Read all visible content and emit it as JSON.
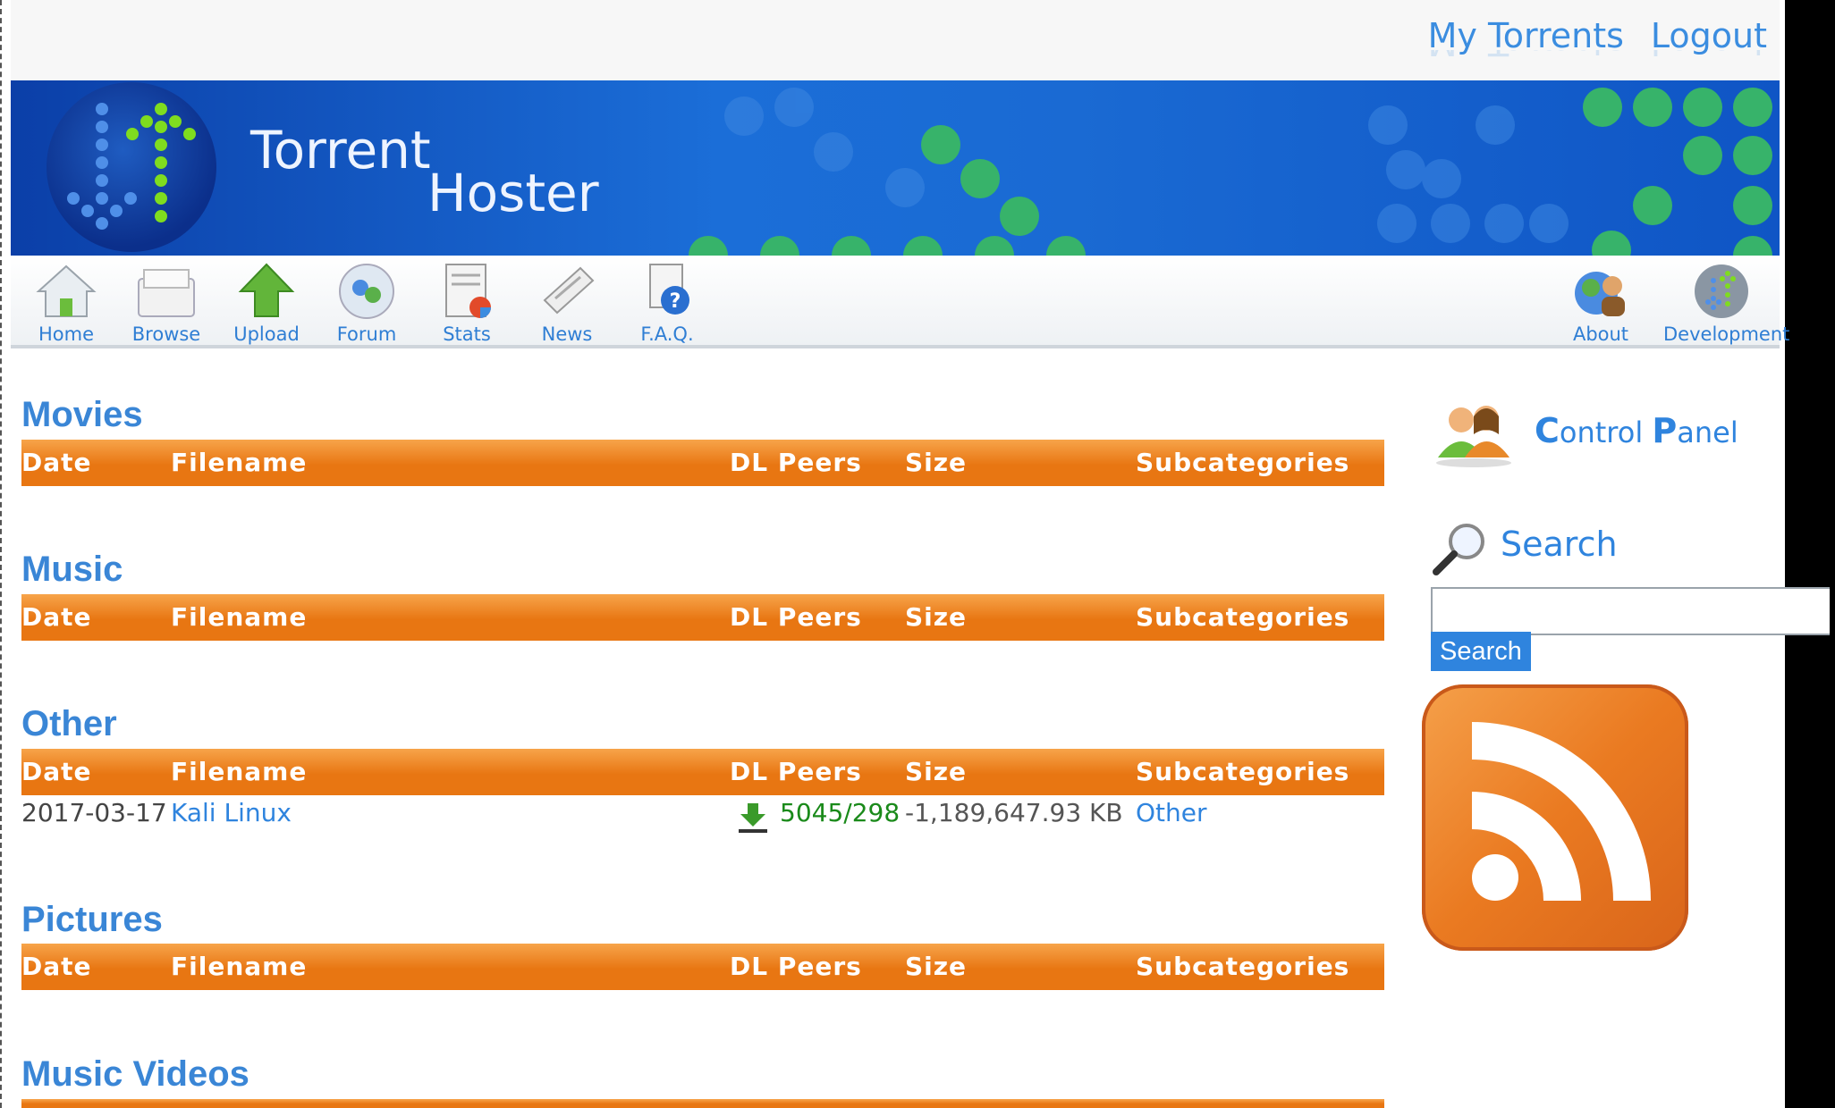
{
  "header": {
    "my_torrents": "My Torrents",
    "logout": "Logout"
  },
  "brand": {
    "line1": "Torrent",
    "line2": "Hoster"
  },
  "nav": {
    "left": [
      {
        "label": "Home",
        "icon": "home-icon"
      },
      {
        "label": "Browse",
        "icon": "browse-icon"
      },
      {
        "label": "Upload",
        "icon": "upload-icon"
      },
      {
        "label": "Forum",
        "icon": "forum-icon"
      },
      {
        "label": "Stats",
        "icon": "stats-icon"
      },
      {
        "label": "News",
        "icon": "news-icon"
      },
      {
        "label": "F.A.Q.",
        "icon": "faq-icon"
      }
    ],
    "right": [
      {
        "label": "About",
        "icon": "about-icon"
      },
      {
        "label": "Development",
        "icon": "development-icon"
      }
    ]
  },
  "table_columns": {
    "date": "Date",
    "filename": "Filename",
    "dl_peers": "DL Peers",
    "size": "Size",
    "subcategories": "Subcategories"
  },
  "sections": [
    {
      "title": "Movies",
      "rows": []
    },
    {
      "title": "Music",
      "rows": []
    },
    {
      "title": "Other",
      "rows": [
        {
          "date": "2017-03-17",
          "filename": "Kali Linux",
          "peers": "5045/298",
          "size": "-1,189,647.93 KB",
          "subcategory": "Other"
        }
      ]
    },
    {
      "title": "Pictures",
      "rows": []
    },
    {
      "title": "Music Videos",
      "rows": []
    }
  ],
  "sidebar": {
    "control_panel_c": "C",
    "control_panel_rest1": "ontrol ",
    "control_panel_p": "P",
    "control_panel_rest2": "anel",
    "search_title": "Search",
    "search_value": "",
    "search_button": "Search"
  },
  "colors": {
    "accent": "#3a86d6",
    "table_header": "#e87612",
    "peers": "#1a8a1a",
    "banner": "#1b6ed8"
  }
}
